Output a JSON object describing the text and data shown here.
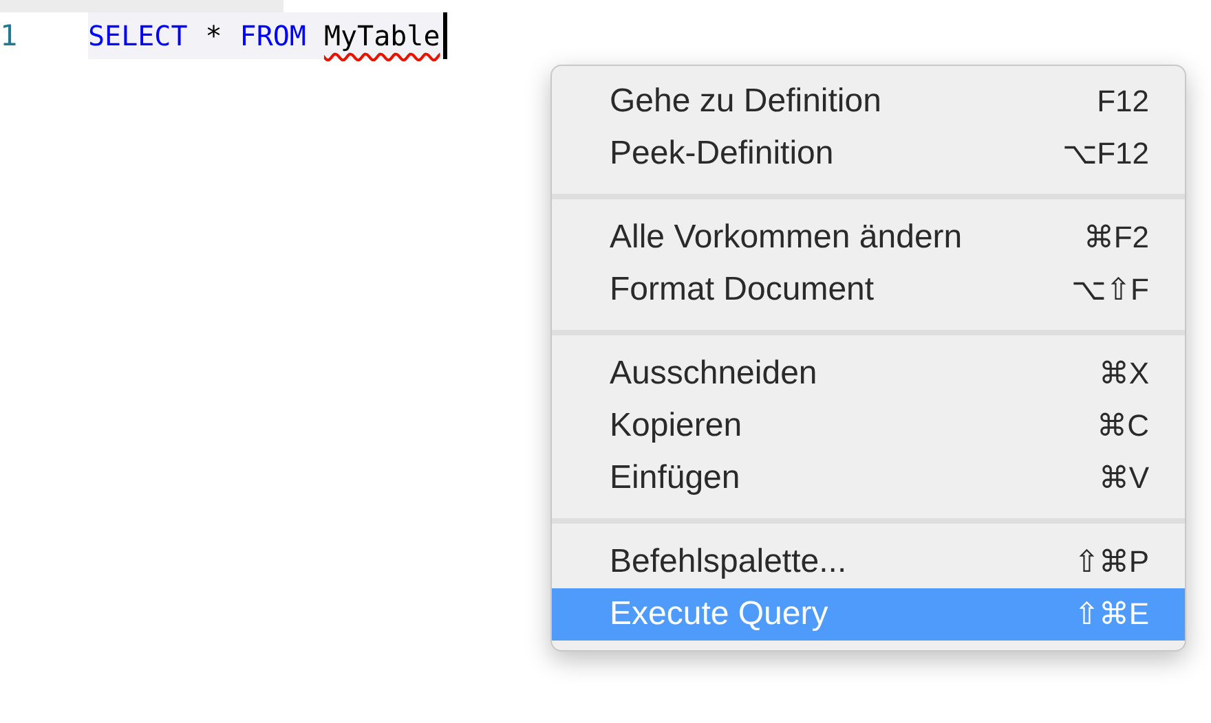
{
  "editor": {
    "line_number": "1",
    "tokens": [
      {
        "text": "SELECT",
        "kind": "keyword",
        "error": false
      },
      {
        "text": "*",
        "kind": "operator",
        "error": false
      },
      {
        "text": "FROM",
        "kind": "keyword",
        "error": false
      },
      {
        "text": "MyTable",
        "kind": "identifier",
        "error": true
      }
    ]
  },
  "context_menu": {
    "groups": [
      [
        {
          "label": "Gehe zu Definition",
          "shortcut": "F12",
          "selected": false
        },
        {
          "label": "Peek-Definition",
          "shortcut": "⌥F12",
          "selected": false
        }
      ],
      [
        {
          "label": "Alle Vorkommen ändern",
          "shortcut": "⌘F2",
          "selected": false
        },
        {
          "label": "Format Document",
          "shortcut": "⌥⇧F",
          "selected": false
        }
      ],
      [
        {
          "label": "Ausschneiden",
          "shortcut": "⌘X",
          "selected": false
        },
        {
          "label": "Kopieren",
          "shortcut": "⌘C",
          "selected": false
        },
        {
          "label": "Einfügen",
          "shortcut": "⌘V",
          "selected": false
        }
      ],
      [
        {
          "label": "Befehlspalette...",
          "shortcut": "⇧⌘P",
          "selected": false
        },
        {
          "label": "Execute Query",
          "shortcut": "⇧⌘E",
          "selected": true
        }
      ]
    ]
  }
}
